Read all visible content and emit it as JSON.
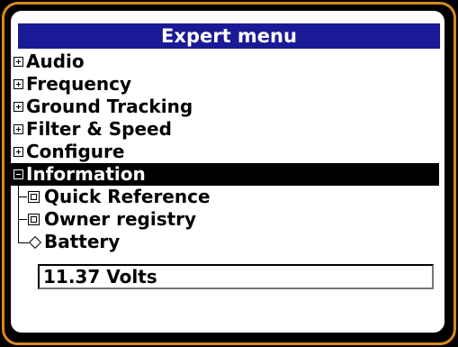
{
  "title": "Expert menu",
  "menu": [
    {
      "label": "Audio",
      "state": "collapsed"
    },
    {
      "label": "Frequency",
      "state": "collapsed"
    },
    {
      "label": "Ground Tracking",
      "state": "collapsed"
    },
    {
      "label": "Filter & Speed",
      "state": "collapsed"
    },
    {
      "label": "Configure",
      "state": "collapsed"
    },
    {
      "label": "Information",
      "state": "expanded",
      "selected": true
    }
  ],
  "submenu": [
    {
      "label": "Quick Reference",
      "icon": "box-icon"
    },
    {
      "label": "Owner registry",
      "icon": "box-icon"
    },
    {
      "label": "Battery",
      "icon": "diamond-icon"
    }
  ],
  "value": "11.37 Volts",
  "colors": {
    "title_bg": "#1a1a96",
    "bezel": "#d68a1c",
    "selected_bg": "#000000"
  }
}
